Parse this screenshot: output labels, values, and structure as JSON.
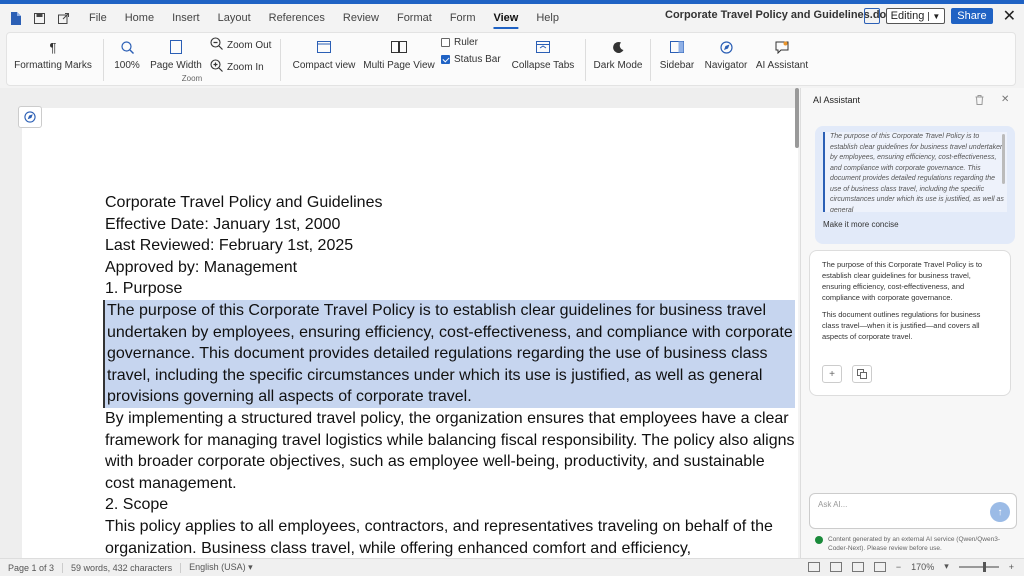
{
  "menu": {
    "items": [
      "File",
      "Home",
      "Insert",
      "Layout",
      "References",
      "Review",
      "Format",
      "Form",
      "View",
      "Help"
    ],
    "active": "View"
  },
  "title": "Corporate Travel Policy and Guidelines.docx",
  "editing_label": "Editing",
  "share_label": "Share",
  "ribbon": {
    "formatting_marks": "Formatting Marks",
    "zoom_100": "100%",
    "page_width": "Page Width",
    "zoom_out": "Zoom Out",
    "zoom_in": "Zoom In",
    "zoom_group": "Zoom",
    "compact_view": "Compact view",
    "multi_page_view": "Multi Page View",
    "ruler": "Ruler",
    "ruler_checked": false,
    "status_bar": "Status Bar",
    "status_bar_checked": true,
    "collapse_tabs": "Collapse Tabs",
    "dark_mode": "Dark Mode",
    "sidebar": "Sidebar",
    "navigator": "Navigator",
    "ai_assistant": "AI Assistant"
  },
  "document": {
    "title": "Corporate Travel Policy and Guidelines",
    "effective": "Effective Date: January 1st, 2000",
    "reviewed": "Last Reviewed: February 1st, 2025",
    "approved": "Approved by: Management",
    "h1": "1. Purpose",
    "selected_para": "The purpose of this Corporate Travel Policy is to establish clear guidelines for business travel undertaken by employees, ensuring efficiency, cost-effectiveness, and compliance with corporate governance. This document provides detailed regulations regarding the use of business class travel, including the specific circumstances under which its use is justified, as well as general provisions governing all aspects of corporate travel.",
    "para2": "By implementing a structured travel policy, the organization ensures that employees have a clear framework for managing travel logistics while balancing fiscal responsibility. The policy also aligns with broader corporate objectives, such as employee well-being, productivity, and sustainable cost management.",
    "h2": "2. Scope",
    "para3": "This policy applies to all employees, contractors, and representatives traveling on behalf of the organization. Business class travel, while offering enhanced comfort and efficiency,"
  },
  "ai": {
    "header": "AI Assistant",
    "quote": "The purpose of this Corporate Travel Policy is to establish clear guidelines for business travel undertaken by employees, ensuring efficiency, cost-effectiveness, and compliance with corporate governance. This document provides detailed regulations regarding the use of business class travel, including the specific circumstances under which its use is justified, as well as general",
    "request": "Make it more concise",
    "response1": "The purpose of this Corporate Travel Policy is to establish clear guidelines for business travel, ensuring efficiency, cost-effectiveness, and compliance with corporate governance.",
    "response2": "This document outlines regulations for business class travel—when it is justified—and covers all aspects of corporate travel.",
    "ask_placeholder": "Ask AI...",
    "disclaimer": "Content generated by an external AI service (Qwen/Qwen3-Coder-Next). Please review before use."
  },
  "status": {
    "page": "Page 1 of 3",
    "words": "59 words, 432 characters",
    "language": "English (USA)",
    "zoom": "170%"
  }
}
